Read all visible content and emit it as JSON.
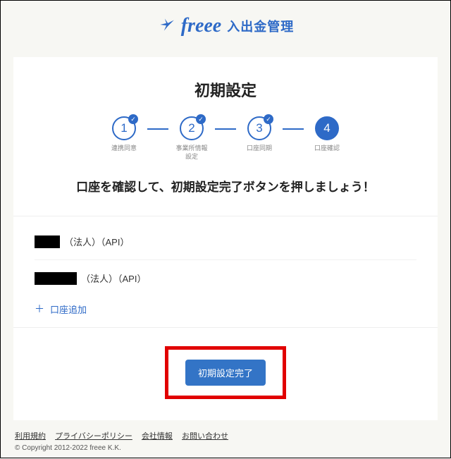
{
  "header": {
    "brand": "freee",
    "product": "入出金管理"
  },
  "setup": {
    "title": "初期設定",
    "steps": [
      {
        "num": "1",
        "label": "連携同意",
        "done": true,
        "active": false
      },
      {
        "num": "2",
        "label": "事業所情報\n設定",
        "done": true,
        "active": false
      },
      {
        "num": "3",
        "label": "口座同期",
        "done": true,
        "active": false
      },
      {
        "num": "4",
        "label": "口座確認",
        "done": false,
        "active": true
      }
    ],
    "instruction": "口座を確認して、初期設定完了ボタンを押しましょう！"
  },
  "accounts": {
    "items": [
      {
        "suffix": "（法人）（API）",
        "mask_w": 36
      },
      {
        "suffix": "（法人）（API）",
        "mask_w": 60
      }
    ],
    "add_label": "口座追加"
  },
  "submit": {
    "label": "初期設定完了"
  },
  "footer": {
    "links": [
      "利用規約",
      "プライバシーポリシー",
      "会社情報",
      "お問い合わせ"
    ],
    "copyright": "© Copyright 2012-2022 freee K.K."
  }
}
